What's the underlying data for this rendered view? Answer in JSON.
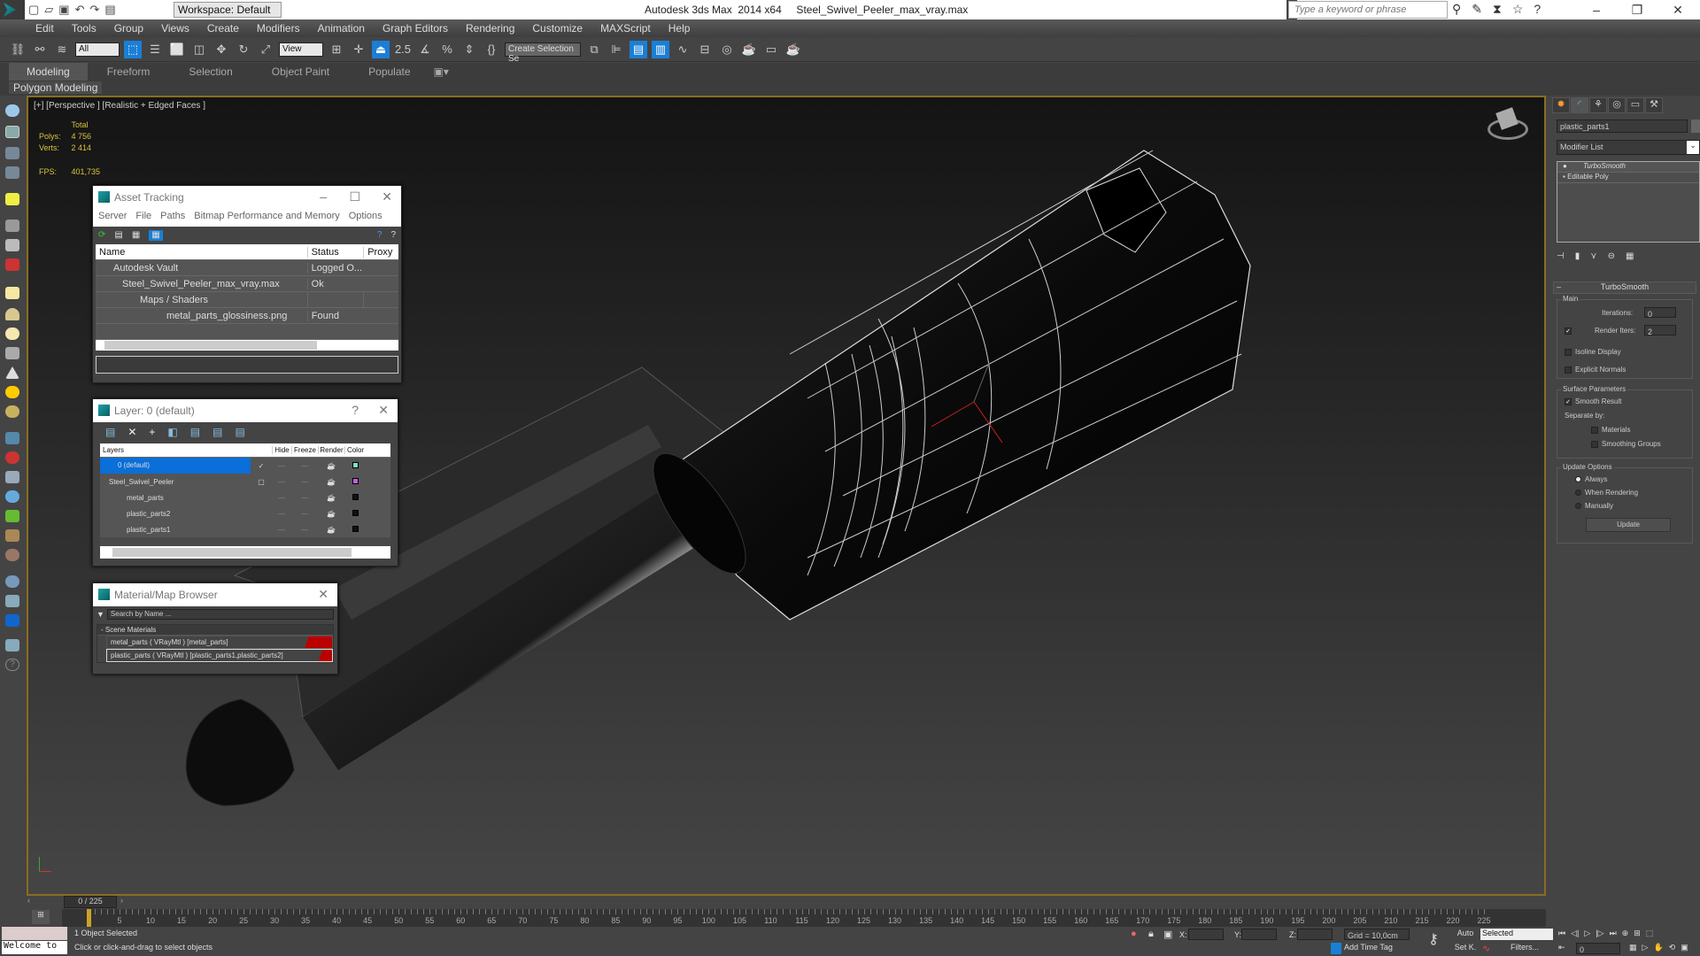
{
  "app": {
    "title": "Autodesk 3ds Max  2014 x64     Steel_Swivel_Peeler_max_vray.max",
    "workspace": "Workspace: Default",
    "search_placeholder": "Type a keyword or phrase",
    "window_controls": [
      "minimize",
      "restore",
      "close"
    ]
  },
  "menu": [
    "Edit",
    "Tools",
    "Group",
    "Views",
    "Create",
    "Modifiers",
    "Animation",
    "Graph Editors",
    "Rendering",
    "Customize",
    "MAXScript",
    "Help"
  ],
  "toolbar": {
    "selection_filter": "All",
    "ref_coord": "View",
    "named_selection": "Create Selection Se",
    "snap_angle_label": "2.5"
  },
  "ribbon": {
    "tabs": [
      "Modeling",
      "Freeform",
      "Selection",
      "Object Paint",
      "Populate"
    ],
    "active_tab": "Modeling",
    "panel": "Polygon Modeling"
  },
  "viewport": {
    "label": "[+] [Perspective ] [Realistic + Edged Faces ]",
    "stats": {
      "header": "Total",
      "polys_label": "Polys:",
      "polys": "4 756",
      "verts_label": "Verts:",
      "verts": "2 414",
      "fps_label": "FPS:",
      "fps": "401,735"
    },
    "border_color": "#8a6d22"
  },
  "asset_tracking": {
    "title": "Asset Tracking",
    "menu": [
      "Server",
      "File",
      "Paths",
      "Bitmap Performance and Memory",
      "Options"
    ],
    "columns": [
      "Name",
      "Status",
      "Proxy"
    ],
    "rows": [
      {
        "name": "Autodesk Vault",
        "status": "Logged O...",
        "proxy": "",
        "indent": 1
      },
      {
        "name": "Steel_Swivel_Peeler_max_vray.max",
        "status": "Ok",
        "proxy": "",
        "indent": 2
      },
      {
        "name": "Maps / Shaders",
        "status": "",
        "proxy": "",
        "indent": 3
      },
      {
        "name": "metal_parts_glossiness.png",
        "status": "Found",
        "proxy": "",
        "indent": 4
      }
    ]
  },
  "layer_manager": {
    "title": "Layer: 0 (default)",
    "columns": [
      "Layers",
      "",
      "Hide",
      "Freeze",
      "Render",
      "Color"
    ],
    "rows": [
      {
        "name": "0 (default)",
        "active": "✓",
        "color": "#7fe0d0",
        "selected": true
      },
      {
        "name": "Steel_Swivel_Peeler",
        "active": "▢",
        "color": "#c060e0"
      },
      {
        "name": "metal_parts",
        "active": "",
        "color": "#111111"
      },
      {
        "name": "plastic_parts2",
        "active": "",
        "color": "#111111"
      },
      {
        "name": "plastic_parts1",
        "active": "",
        "color": "#111111"
      }
    ]
  },
  "material_browser": {
    "title": "Material/Map Browser",
    "search_placeholder": "Search by Name ...",
    "group": "- Scene Materials",
    "items": [
      "metal_parts  ( VRayMtl ) [metal_parts]",
      "plastic_parts ( VRayMtl ) [plastic_parts1,plastic_parts2]"
    ]
  },
  "command_panel": {
    "object_name": "plastic_parts1",
    "modifier_list": "Modifier List",
    "stack": [
      "TurboSmooth",
      "Editable Poly"
    ],
    "rollout": "TurboSmooth",
    "main_label": "Main",
    "iterations_label": "Iterations:",
    "iterations": "0",
    "render_iters_label": "Render Iters:",
    "render_iters": "2",
    "render_iters_checked": true,
    "isoline_label": "Isoline Display",
    "explicit_label": "Explicit Normals",
    "surface_label": "Surface Parameters",
    "smooth_result_label": "Smooth Result",
    "smooth_result_checked": true,
    "separate_label": "Separate by:",
    "materials_label": "Materials",
    "smoothing_label": "Smoothing Groups",
    "update_label": "Update Options",
    "always_label": "Always",
    "when_rendering_label": "When Rendering",
    "manually_label": "Manually",
    "update_button": "Update"
  },
  "timeline": {
    "frame": "0 / 225",
    "ticks": [
      5,
      10,
      15,
      20,
      25,
      30,
      35,
      40,
      45,
      50,
      55,
      60,
      65,
      70,
      75,
      80,
      85,
      90,
      95,
      100,
      105,
      110,
      115,
      120,
      125,
      130,
      135,
      140,
      145,
      150,
      155,
      160,
      165,
      170,
      175,
      180,
      185,
      190,
      195,
      200,
      205,
      210,
      215,
      220,
      225
    ]
  },
  "status": {
    "maxscript": "Welcome to",
    "selected": "1 Object Selected",
    "prompt": "Click or click-and-drag to select objects",
    "x_label": "X:",
    "y_label": "Y:",
    "z_label": "Z:",
    "grid": "Grid = 10,0cm",
    "add_time_tag": "Add Time Tag",
    "auto": "Auto",
    "setk": "Set K.",
    "key_filter": "Selected",
    "filters": "Filters...",
    "current_frame": "0"
  }
}
